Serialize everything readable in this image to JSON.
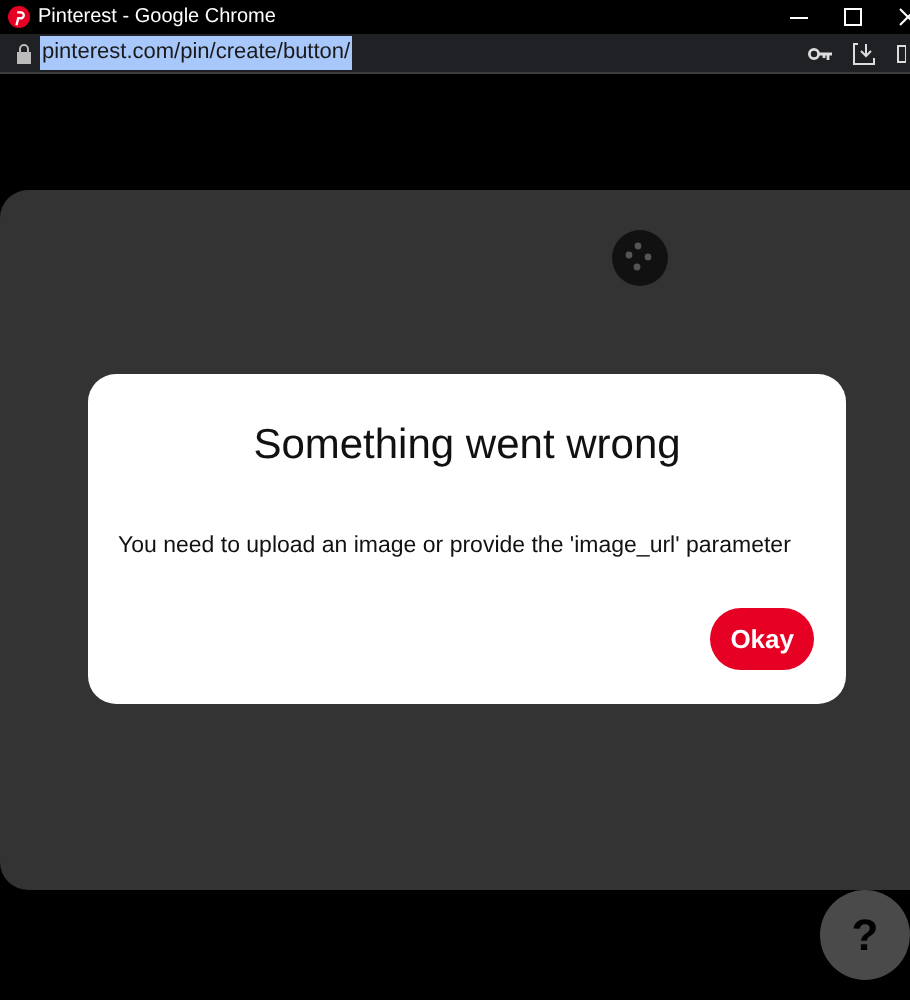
{
  "window": {
    "title": "Pinterest - Google Chrome"
  },
  "address_bar": {
    "url": "pinterest.com/pin/create/button/",
    "url_selected": true
  },
  "dialog": {
    "title": "Something went wrong",
    "message": "You need to upload an image or provide the 'image_url' parameter",
    "buttons": [
      "Okay"
    ]
  },
  "help_button": {
    "label": "?"
  }
}
